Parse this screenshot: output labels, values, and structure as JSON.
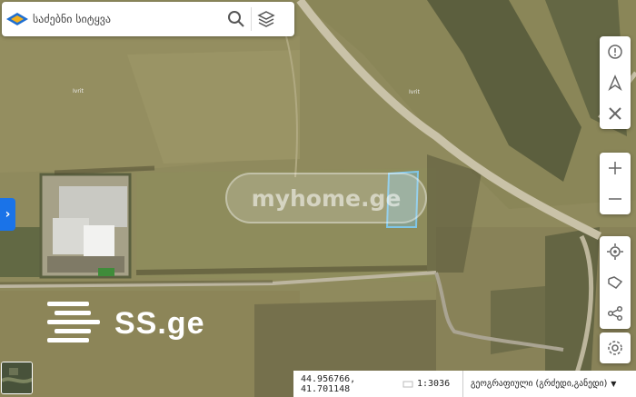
{
  "search": {
    "placeholder": "საძებნი სიტყვა"
  },
  "map": {
    "road_labels": [
      "Ivrit",
      "Ivrit"
    ],
    "parcel_color": "#7fc6e8"
  },
  "watermarks": {
    "myhome": "myhome.ge",
    "ss": "SS.ge"
  },
  "status": {
    "coords": "44.956766, 41.701148",
    "scale": "1:3036",
    "crs": "გეოგრაფიული (გრძედი,განედი)"
  },
  "icons": {
    "logo": "map-logo-icon",
    "search": "search-icon",
    "layers": "layers-icon",
    "side_tab": "chevron-right-icon",
    "controls": [
      "info-icon",
      "north-arrow-icon",
      "tools-icon",
      "zoom-in-icon",
      "zoom-out-icon",
      "locate-icon",
      "measure-icon",
      "share-icon",
      "settings-icon"
    ]
  },
  "colors": {
    "accent": "#1a73e8"
  }
}
